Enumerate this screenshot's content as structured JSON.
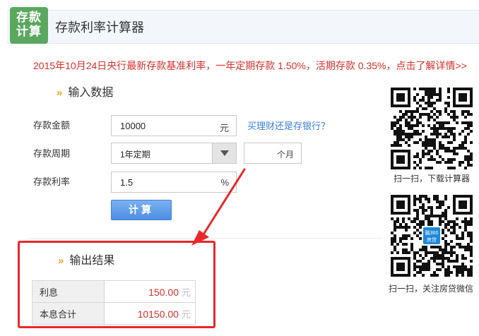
{
  "header": {
    "logo_line1": "存款",
    "logo_line2": "计算",
    "title": "存款利率计算器"
  },
  "notice": "2015年10月24日央行最新存款基准利率，一年定期存款 1.50%，活期存款 0.35%，点击了解详情>>",
  "input_section": {
    "title": "输入数据",
    "amount_label": "存款金额",
    "amount_value": "10000",
    "amount_unit": "元",
    "link_text": "买理财还是存银行？",
    "period_label": "存款周期",
    "period_value": "1年定期",
    "months_unit": "个月",
    "rate_label": "存款利率",
    "rate_value": "1.5",
    "rate_unit": "%",
    "calc_button": "计算"
  },
  "output_section": {
    "title": "输出结果",
    "rows": [
      {
        "label": "利息",
        "value": "150.00",
        "unit": "元"
      },
      {
        "label": "本息合计",
        "value": "10150.00",
        "unit": "元"
      }
    ]
  },
  "qr": {
    "caption1": "扫一扫，下载计算器",
    "badge_line1": "融360",
    "badge_line2": "房贷",
    "caption2": "扫一扫，关注房贷微信"
  },
  "colors": {
    "accent_red": "#d8302a",
    "brand_green": "#5aa85f",
    "link_blue": "#3b7fd4",
    "arrow_orange": "#f2a52b",
    "annotation_red": "#e8282b"
  }
}
